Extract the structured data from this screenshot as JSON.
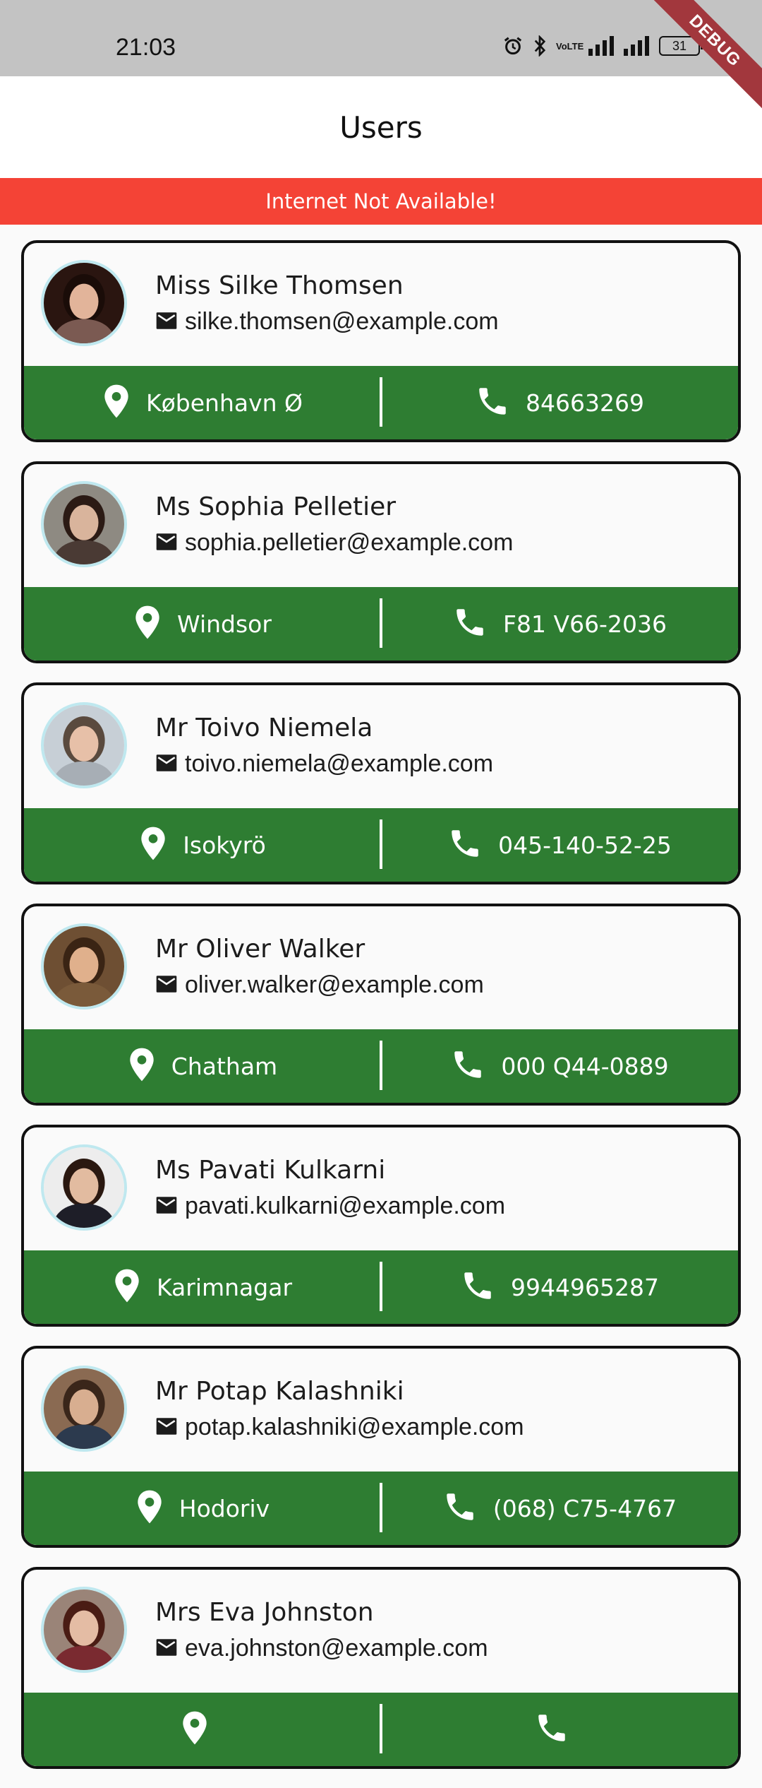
{
  "status_bar": {
    "time": "21:03",
    "battery": "31",
    "network_label": "VoLTE"
  },
  "debug_banner": "DEBUG",
  "app_bar": {
    "title": "Users"
  },
  "offline_banner": "Internet Not Available!",
  "users": [
    {
      "name": "Miss Silke Thomsen",
      "email": "silke.thomsen@example.com",
      "city": "København Ø",
      "phone": "84663269",
      "avatar": {
        "bg": "#2a1510",
        "skin": "#e2b49a",
        "hair": "#1a0c08",
        "shirt": "#7b5a52"
      }
    },
    {
      "name": "Ms Sophia Pelletier",
      "email": "sophia.pelletier@example.com",
      "city": "Windsor",
      "phone": "F81 V66-2036",
      "avatar": {
        "bg": "#8e8a82",
        "skin": "#d9b49c",
        "hair": "#2b1a14",
        "shirt": "#4a3a34"
      }
    },
    {
      "name": "Mr Toivo Niemela",
      "email": "toivo.niemela@example.com",
      "city": "Isokyrö",
      "phone": "045-140-52-25",
      "avatar": {
        "bg": "#c7cfd6",
        "skin": "#e7c0a8",
        "hair": "#5a4a3e",
        "shirt": "#a7aeb5"
      }
    },
    {
      "name": "Mr Oliver Walker",
      "email": "oliver.walker@example.com",
      "city": "Chatham",
      "phone": "000 Q44-0889",
      "avatar": {
        "bg": "#6e4f33",
        "skin": "#e0b08c",
        "hair": "#3a2414",
        "shirt": "#7a5a3a"
      }
    },
    {
      "name": "Ms Pavati Kulkarni",
      "email": "pavati.kulkarni@example.com",
      "city": "Karimnagar",
      "phone": "9944965287",
      "avatar": {
        "bg": "#ededed",
        "skin": "#e2bba0",
        "hair": "#2a1810",
        "shirt": "#1e1e28"
      }
    },
    {
      "name": "Mr Potap Kalashniki",
      "email": "potap.kalashniki@example.com",
      "city": "Hodoriv",
      "phone": "(068) C75-4767",
      "avatar": {
        "bg": "#8a6a52",
        "skin": "#d8ae90",
        "hair": "#3a261a",
        "shirt": "#2c3a4e"
      }
    },
    {
      "name": "Mrs Eva Johnston",
      "email": "eva.johnston@example.com",
      "city": "",
      "phone": "",
      "avatar": {
        "bg": "#9a8478",
        "skin": "#e4bca4",
        "hair": "#4a1c14",
        "shirt": "#7a2a30"
      }
    }
  ],
  "colors": {
    "status_bar": "#c3c3c3",
    "offline_banner": "#f44336",
    "card_footer": "#2e7d32",
    "card_border": "#111111",
    "debug_banner": "#a2373d"
  },
  "icons": {
    "email": "mail-icon",
    "location": "location-pin-icon",
    "phone": "phone-icon"
  }
}
